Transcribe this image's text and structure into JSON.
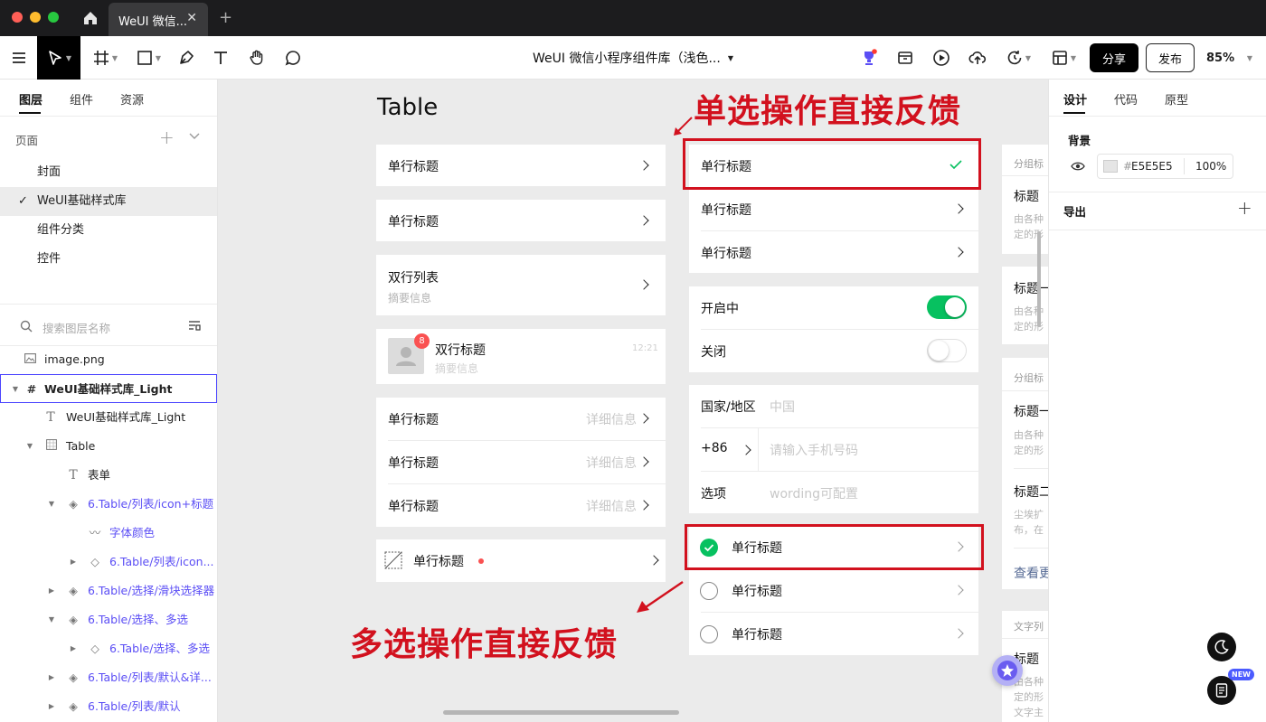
{
  "titlebar": {
    "tab_title": "WeUI 微信..."
  },
  "toolbar": {
    "doc_title": "WeUI 微信小程序组件库（浅色...",
    "share_label": "分享",
    "publish_label": "发布",
    "zoom": "85%"
  },
  "left_panel": {
    "tabs": [
      "图层",
      "组件",
      "资源"
    ],
    "pages_label": "页面",
    "pages": [
      "封面",
      "WeUI基础样式库",
      "组件分类",
      "控件"
    ],
    "search_placeholder": "搜索图层名称",
    "layers": [
      "image.png",
      "WeUI基础样式库_Light",
      "WeUI基础样式库_Light",
      "Table",
      "表单",
      "6.Table/列表/icon+标题",
      "字体颜色",
      "6.Table/列表/icon...",
      "6.Table/选择/滑块选择器",
      "6.Table/选择、多选",
      "6.Table/选择、多选",
      "6.Table/列表/默认&详...",
      "6.Table/列表/默认"
    ]
  },
  "canvas": {
    "heading": "Table",
    "left_col": {
      "row_title": "单行标题",
      "double_title": "双行列表",
      "summary": "摘要信息",
      "chat_title": "双行标题",
      "chat_summary": "摘要信息",
      "chat_time": "12:21",
      "badge": "8",
      "detail": "详细信息"
    },
    "right_col": {
      "row_title": "单行标题",
      "switch_on_label": "开启中",
      "switch_off_label": "关闭",
      "country_label": "国家/地区",
      "country_value": "中国",
      "phone_code": "+86",
      "phone_placeholder": "请输入手机号码",
      "option_label": "选项",
      "option_placeholder": "wording可配置"
    },
    "annotations": {
      "single": "单选操作直接反馈",
      "multi": "多选操作直接反馈"
    },
    "partial_col": {
      "group_label_1": "分组标",
      "title_1": "标题",
      "desc_1a": "由各种",
      "desc_1b": "定的形",
      "title_2": "标题一",
      "desc_2a": "由各种",
      "desc_2b": "定的形",
      "group_label_2": "分组标",
      "title_3": "标题一",
      "desc_3a": "由各种",
      "desc_3b": "定的形",
      "title_4": "标题二",
      "desc_4a": "尘埃扩",
      "desc_4b": "布，在",
      "more": "查看更",
      "group_label_3": "文字列",
      "title_5": "标题",
      "desc_5a": "由各种",
      "desc_5b": "定的形",
      "desc_5c": "文字主"
    }
  },
  "right_panel": {
    "tabs": [
      "设计",
      "代码",
      "原型"
    ],
    "background_label": "背景",
    "bg_color": "E5E5E5",
    "bg_opacity": "100",
    "export_label": "导出",
    "new_badge": "NEW"
  },
  "colors": {
    "accent_green": "#07c160",
    "annotation_red": "#d2111e",
    "layer_purple": "#5b4ef5",
    "canvas_bg": "#ebebeb"
  }
}
